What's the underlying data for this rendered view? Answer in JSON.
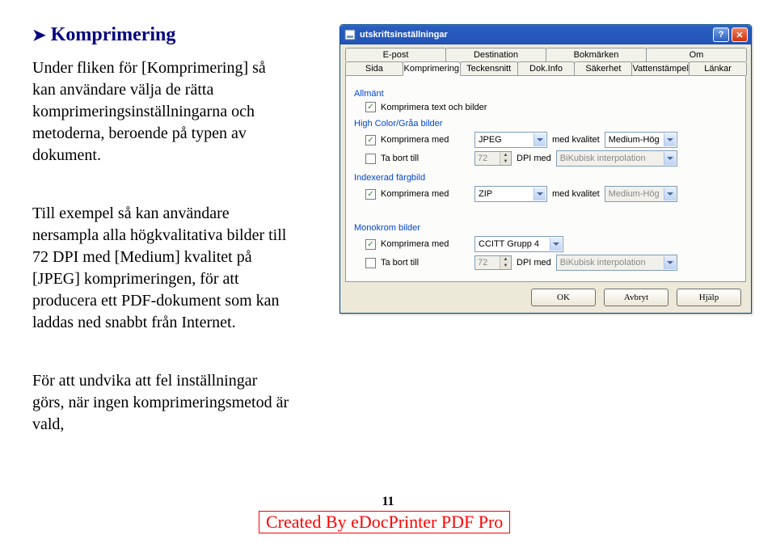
{
  "doc": {
    "heading": "Komprimering",
    "p1": "Under fliken för [Komprimering] så kan användare välja de rätta komprimeringsinställningarna och metoderna, beroende på typen av dokument.",
    "p2": "Till exempel så kan användare nersampla alla högkvalitativa bilder till 72 DPI med [Medium] kvalitet på [JPEG] komprimeringen, för att producera ett PDF-dokument som kan laddas ned snabbt från Internet.",
    "p3": "För att undvika att fel inställningar görs, när ingen komprimeringsmetod är vald,"
  },
  "dialog": {
    "title": "utskriftsinställningar",
    "tabs_row1": [
      "E-post",
      "Destination",
      "Bokmärken",
      "Om"
    ],
    "tabs_row2": [
      "Sida",
      "Komprimering",
      "Teckensnitt",
      "Dok.Info",
      "Säkerhet",
      "Vattenstämpel",
      "Länkar"
    ],
    "active_tab": "Komprimering",
    "grp_allmant": "Allmänt",
    "cbx_textimg": "Komprimera text och bilder",
    "grp_high": "High Color/Gråa bilder",
    "cbx_compwith": "Komprimera med",
    "cbx_downto": "Ta bort till",
    "lbl_dpi_med": "DPI   med",
    "lbl_med_kvalitet": "med   kvalitet",
    "grp_indexed": "Indexerad färgbild",
    "grp_mono": "Monokrom bilder",
    "high": {
      "method": "JPEG",
      "quality": "Medium-Hög",
      "dpi": "72",
      "interp": "BiKubisk interpolation"
    },
    "indexed": {
      "method": "ZIP",
      "quality": "Medium-Hög"
    },
    "mono": {
      "method": "CCITT Grupp 4",
      "dpi": "72",
      "interp": "BiKubisk interpolation"
    },
    "buttons": {
      "ok": "OK",
      "cancel": "Avbryt",
      "help": "Hjälp"
    }
  },
  "footer": {
    "page": "11",
    "credit": "Created By eDocPrinter PDF Pro"
  }
}
